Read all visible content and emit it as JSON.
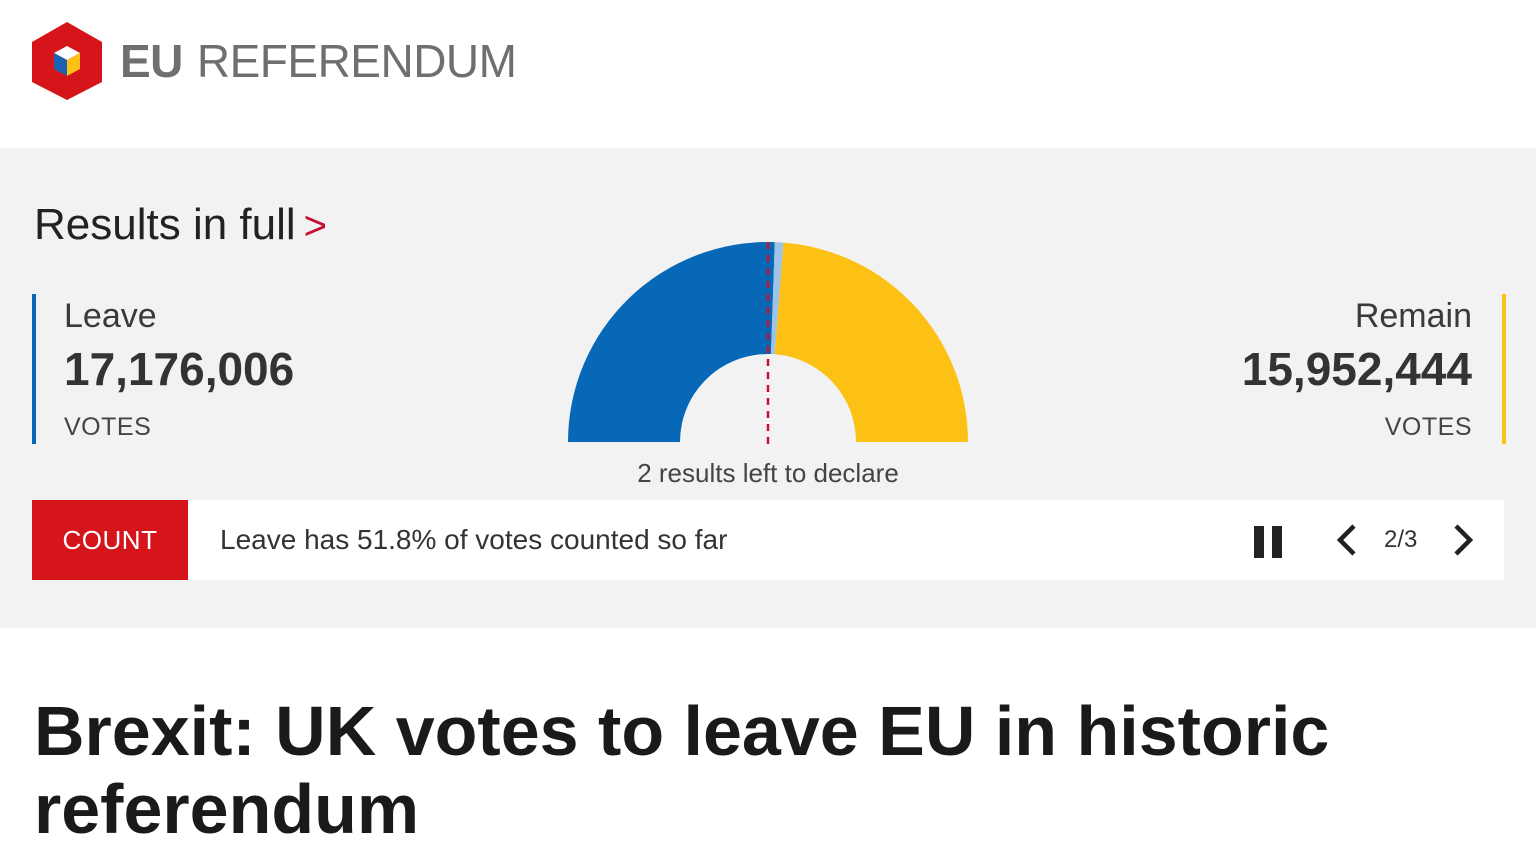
{
  "brand": {
    "part1": "EU",
    "part2": "REFERENDUM"
  },
  "results_link": {
    "label": "Results in full",
    "chevron": ">"
  },
  "leave": {
    "label": "Leave",
    "votes": "17,176,006",
    "unit": "VOTES",
    "color": "#0868b8",
    "share": 0.518
  },
  "remain": {
    "label": "Remain",
    "votes": "15,952,444",
    "unit": "VOTES",
    "color": "#fdc115",
    "share": 0.482
  },
  "gauge": {
    "uncounted_color": "#9ec3e6",
    "majority_line_color": "#c8102e"
  },
  "declare_text": "2 results left to declare",
  "ticker": {
    "badge": "COUNT",
    "text": "Leave has 51.8% of votes counted so far",
    "pager": "2/3",
    "icons": {
      "pause": "pause-icon",
      "prev": "chevron-left-icon",
      "next": "chevron-right-icon"
    }
  },
  "headline": "Brexit: UK votes to leave EU in historic referendum",
  "colors": {
    "count_badge": "#d6151b",
    "panel_bg": "#f2f2f2"
  }
}
